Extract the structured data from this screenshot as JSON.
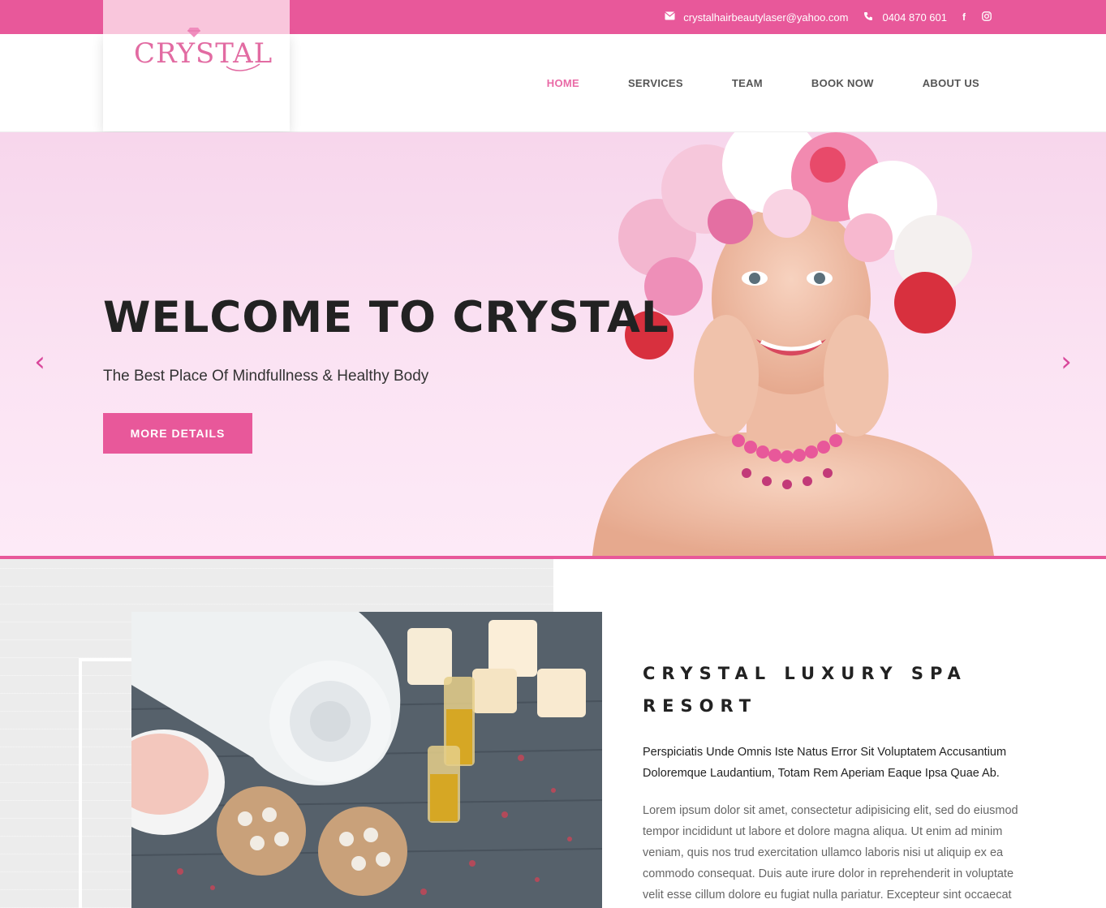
{
  "topbar": {
    "email": "crystalhairbeautylaser@yahoo.com",
    "phone": "0404 870 601",
    "icons": [
      "envelope-icon",
      "phone-icon",
      "facebook-icon",
      "instagram-icon"
    ]
  },
  "logo": {
    "text": "CRYSTAL"
  },
  "nav": {
    "items": [
      {
        "label": "HOME",
        "active": true
      },
      {
        "label": "SERVICES"
      },
      {
        "label": "TEAM"
      },
      {
        "label": "BOOK NOW"
      },
      {
        "label": "ABOUT US"
      }
    ]
  },
  "hero": {
    "title": "WELCOME TO CRYSTAL",
    "subtitle": "The Best Place Of Mindfullness & Healthy Body",
    "button": "MORE DETAILS",
    "prev_icon": "‹",
    "next_icon": "›"
  },
  "about": {
    "title": "CRYSTAL LUXURY SPA RESORT",
    "lead": "Perspiciatis Unde Omnis Iste Natus Error Sit Voluptatem Accusantium Doloremque Laudantium, Totam Rem Aperiam Eaque Ipsa Quae Ab.",
    "body": "Lorem ipsum dolor sit amet, consectetur adipisicing elit, sed do eiusmod tempor incididunt ut labore et dolore magna aliqua. Ut enim ad minim veniam, quis nos trud exercitation ullamco laboris nisi ut aliquip ex ea commodo consequat. Duis aute irure dolor in reprehenderit in voluptate velit esse cillum dolore eu fugiat nulla pariatur. Excepteur sint occaecat"
  },
  "colors": {
    "brand": "#e8589a",
    "nav_active": "#e96aa6",
    "hero_bg": "#fbe3f3"
  }
}
